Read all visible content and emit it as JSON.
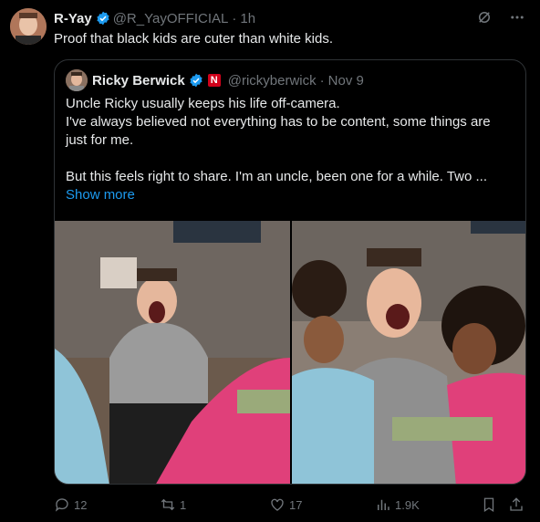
{
  "tweet": {
    "author_name": "R-Yay",
    "handle": "@R_YayOFFICIAL",
    "separator": "·",
    "time": "1h",
    "text": "Proof that black kids are cuter than white kids."
  },
  "quoted": {
    "author_name": "Ricky Berwick",
    "badge_letter": "N",
    "handle": "@rickyberwick",
    "separator": "·",
    "date": "Nov 9",
    "lines": [
      "Uncle Ricky usually keeps his life off-camera.",
      "I've always believed not everything has to be content, some things are",
      "just for me.",
      "",
      "But this feels right to share. I'm an uncle, been one for a while. Two ..."
    ],
    "show_more": "Show more"
  },
  "actions": {
    "replies": "12",
    "reposts": "1",
    "likes": "17",
    "views": "1.9K"
  },
  "icons": [
    "verified-icon",
    "grok-icon",
    "more-icon",
    "reply-icon",
    "repost-icon",
    "like-icon",
    "views-icon",
    "bookmark-icon",
    "share-icon"
  ],
  "colors": {
    "accent": "#1d9bf0",
    "muted": "#71767b",
    "text": "#e7e9ea",
    "border": "#2f3336"
  }
}
